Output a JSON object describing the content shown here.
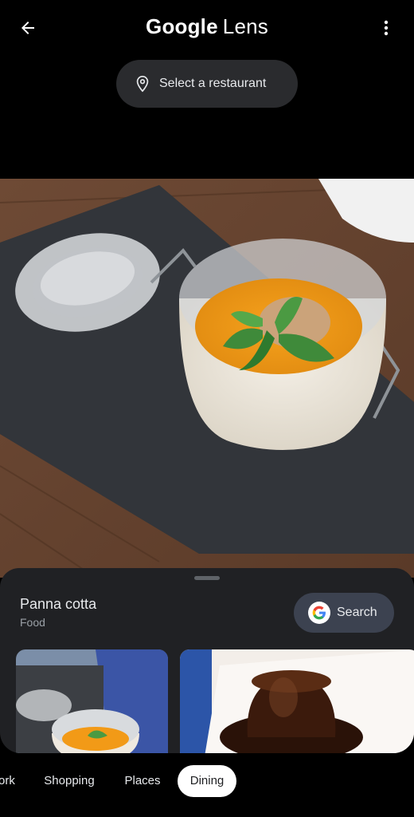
{
  "header": {
    "title_brand": "Google",
    "title_product": "Lens"
  },
  "restaurant_chip": {
    "label": "Select a restaurant"
  },
  "result": {
    "title": "Panna cotta",
    "category": "Food",
    "search_label": "Search"
  },
  "tabs": [
    {
      "label": "ork",
      "active": false
    },
    {
      "label": "Shopping",
      "active": false
    },
    {
      "label": "Places",
      "active": false
    },
    {
      "label": "Dining",
      "active": true
    }
  ],
  "colors": {
    "background": "#000000",
    "sheet": "#202124",
    "chip": "#2a2b2e",
    "search_button": "#3c4250",
    "active_tab": "#ffffff"
  },
  "icons": [
    "arrow-back-icon",
    "more-vert-icon",
    "location-pin-icon",
    "google-g-icon"
  ]
}
